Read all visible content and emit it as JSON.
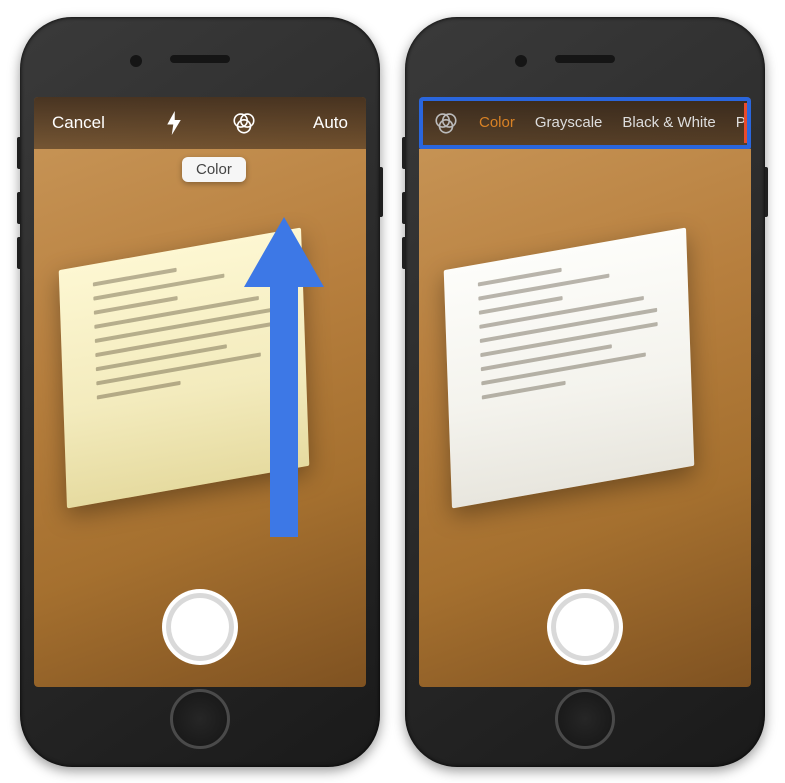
{
  "colors": {
    "accent_orange": "#d98225",
    "callout_blue": "#3d78e6",
    "highlight_border": "#2a66dd",
    "red_mark": "#e84b2c"
  },
  "left_phone": {
    "toolbar": {
      "cancel_label": "Cancel",
      "flash_icon": "flash-icon",
      "filter_icon": "filter-icon",
      "mode_label": "Auto"
    },
    "tooltip_label": "Color",
    "annotation": "arrow-to-filter-icon",
    "shutter": "shutter-button"
  },
  "right_phone": {
    "filter_bar": {
      "icon": "filter-icon",
      "options": [
        "Color",
        "Grayscale",
        "Black & White",
        "Photo"
      ],
      "selected_index": 0
    },
    "shutter": "shutter-button",
    "highlight": "filter-bar-highlight"
  }
}
